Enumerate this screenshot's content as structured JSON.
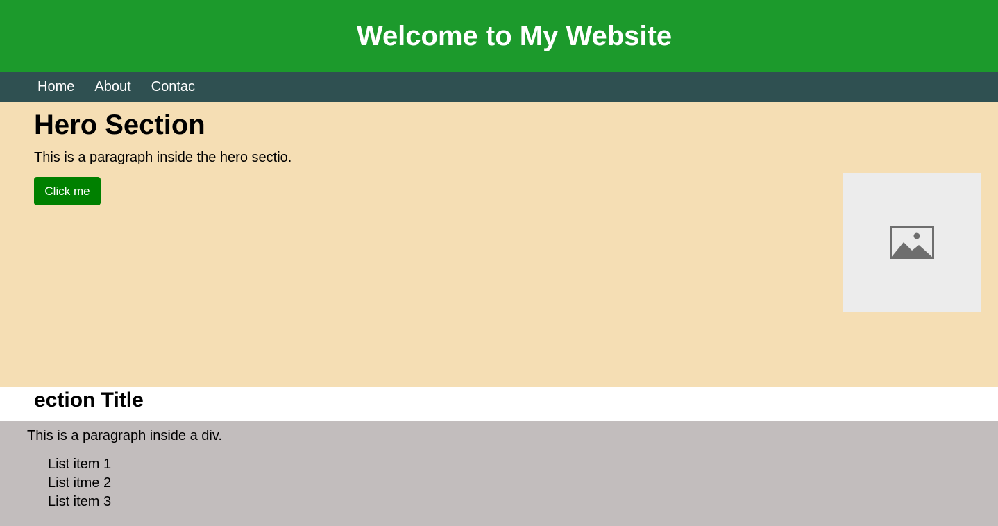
{
  "header": {
    "title": "Welcome to My Website"
  },
  "nav": {
    "items": [
      {
        "label": "Home"
      },
      {
        "label": "About"
      },
      {
        "label": "Contac"
      }
    ]
  },
  "hero": {
    "title": "Hero Section",
    "paragraph": "This is a paragraph inside the hero sectio.",
    "button_label": "Click me",
    "image_icon": "image-placeholder-icon"
  },
  "section": {
    "title": "ection Title"
  },
  "content": {
    "paragraph": "This is a paragraph inside a div.",
    "list": [
      "List item 1",
      "List itme 2",
      "List item 3"
    ]
  },
  "colors": {
    "header_bg": "#1c9a2c",
    "nav_bg": "#2f5051",
    "hero_bg": "#f5deb4",
    "button_bg": "#008000",
    "content_bg": "#c2bdbd"
  }
}
